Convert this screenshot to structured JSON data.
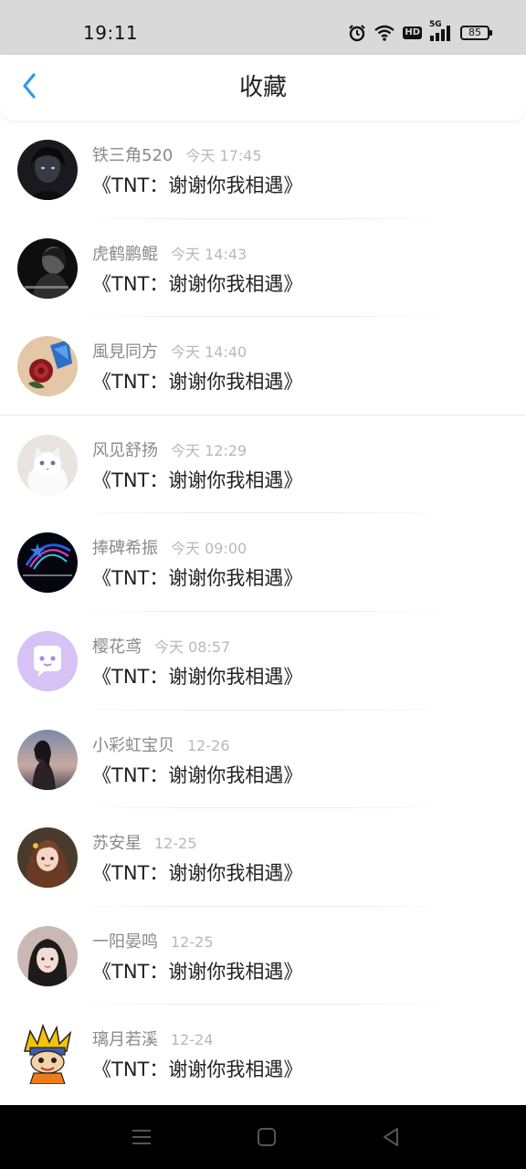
{
  "status_bar": {
    "time": "19:11",
    "network": "5G",
    "hd": "HD",
    "battery": "85",
    "icons": [
      "alarm-icon",
      "wifi-icon",
      "hd-icon",
      "signal-5g-icon",
      "battery-icon"
    ]
  },
  "header": {
    "title": "收藏",
    "back_icon": "chevron-left-icon",
    "accent_color": "#2f9be8"
  },
  "items": [
    {
      "name": "铁三角520",
      "time": "今天 17:45",
      "content": "《TNT：谢谢你我相遇》"
    },
    {
      "name": "虎鹤鹏鲲",
      "time": "今天 14:43",
      "content": "《TNT：谢谢你我相遇》"
    },
    {
      "name": "風見同方",
      "time": "今天 14:40",
      "content": "《TNT：谢谢你我相遇》"
    },
    {
      "name": "风见舒扬",
      "time": "今天 12:29",
      "content": "《TNT：谢谢你我相遇》"
    },
    {
      "name": "捧碑希振",
      "time": "今天 09:00",
      "content": "《TNT：谢谢你我相遇》"
    },
    {
      "name": "樱花鸢",
      "time": "今天 08:57",
      "content": "《TNT：谢谢你我相遇》"
    },
    {
      "name": "小彩虹宝贝",
      "time": "12-26",
      "content": "《TNT：谢谢你我相遇》"
    },
    {
      "name": "苏安星",
      "time": "12-25",
      "content": "《TNT：谢谢你我相遇》"
    },
    {
      "name": "一阳晏鸣",
      "time": "12-25",
      "content": "《TNT：谢谢你我相遇》"
    },
    {
      "name": "璃月若溪",
      "time": "12-24",
      "content": "《TNT：谢谢你我相遇》"
    }
  ],
  "nav_bar": {
    "icons": [
      "menu-icon",
      "home-icon",
      "back-triangle-icon"
    ]
  }
}
